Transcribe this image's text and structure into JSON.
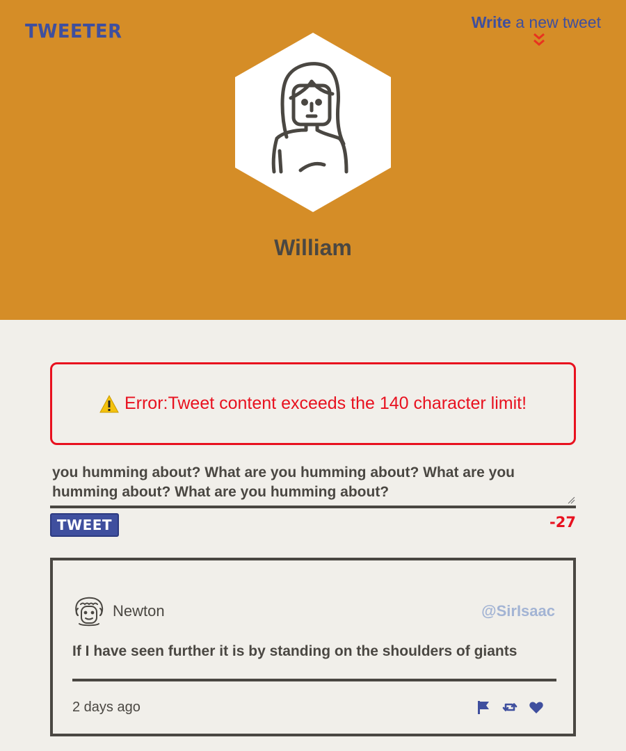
{
  "header": {
    "logo": "TWEETER",
    "write_strong": "Write",
    "write_rest": " a new tweet",
    "user_name": "William"
  },
  "colors": {
    "header_bg": "#d58d27",
    "page_bg": "#f1efea",
    "brand_blue": "#3f4f9e",
    "error_red": "#e8111f",
    "text_dark": "#4a4742",
    "handle_blue": "#a3b4d4"
  },
  "error": {
    "icon": "warning-icon",
    "message": "Error:Tweet content exceeds the 140 character limit!"
  },
  "compose": {
    "text": "you humming about? What are you humming about? What are you humming about? What are you humming about?",
    "button_label": "TWEET",
    "counter": "-27"
  },
  "tweet": {
    "avatar": "newton-avatar",
    "name": "Newton",
    "handle": "@SirIsaac",
    "content": "If I have seen further it is by standing on the shoulders of giants",
    "time": "2 days ago",
    "actions": [
      "flag-icon",
      "retweet-icon",
      "heart-icon"
    ]
  }
}
